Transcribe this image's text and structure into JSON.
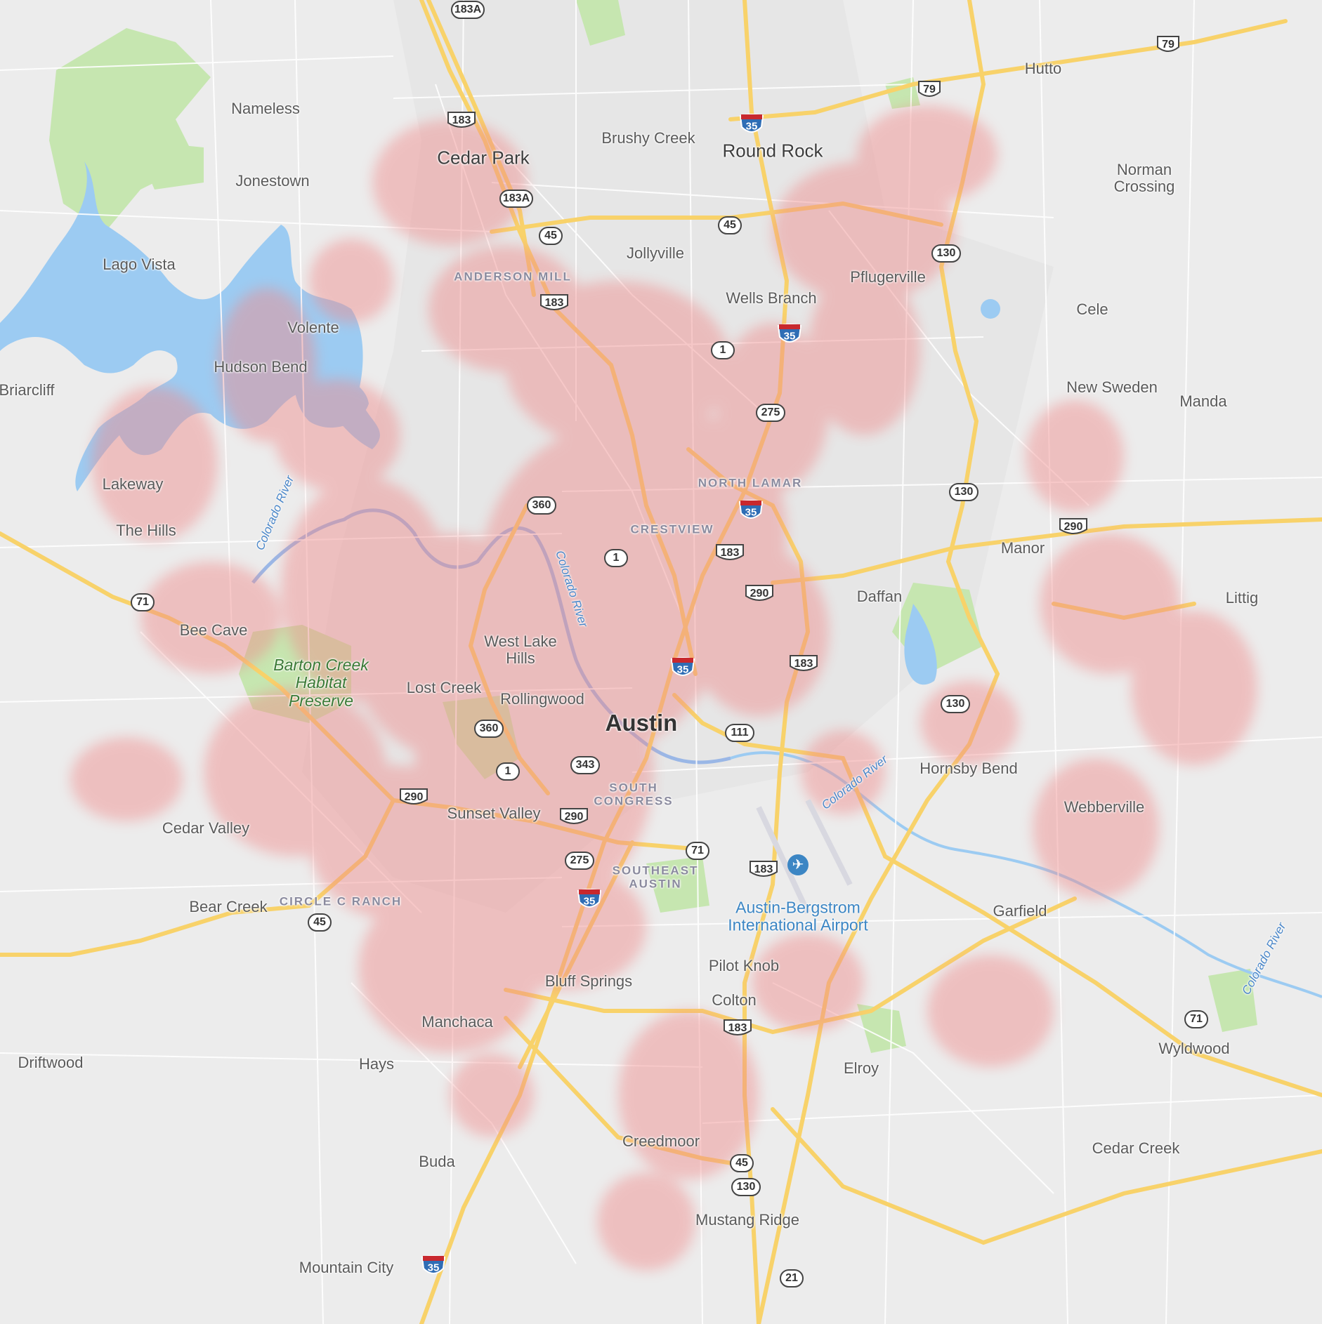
{
  "map": {
    "colors": {
      "land": "#ececec",
      "park": "#c6e6b0",
      "water": "#9ccbf2",
      "highway": "#f8d26a",
      "road": "#ffffff",
      "heat": "#f08a8a",
      "airport": "#3c86c4"
    },
    "places": [
      {
        "name": "Nameless",
        "style": "town"
      },
      {
        "name": "Jonestown",
        "style": "town"
      },
      {
        "name": "Lago Vista",
        "style": "town"
      },
      {
        "name": "Volente",
        "style": "town"
      },
      {
        "name": "Hudson Bend",
        "style": "town"
      },
      {
        "name": "Briarcliff",
        "style": "town"
      },
      {
        "name": "Lakeway",
        "style": "town"
      },
      {
        "name": "The Hills",
        "style": "town"
      },
      {
        "name": "Bee Cave",
        "style": "town"
      },
      {
        "name": "Cedar Park",
        "style": "big"
      },
      {
        "name": "Brushy Creek",
        "style": "town"
      },
      {
        "name": "Round Rock",
        "style": "big"
      },
      {
        "name": "Hutto",
        "style": "town"
      },
      {
        "name": "Norman Crossing",
        "style": "town"
      },
      {
        "name": "Jollyville",
        "style": "town"
      },
      {
        "name": "Pflugerville",
        "style": "town"
      },
      {
        "name": "Wells Branch",
        "style": "town"
      },
      {
        "name": "Cele",
        "style": "town"
      },
      {
        "name": "New Sweden",
        "style": "town"
      },
      {
        "name": "Manda",
        "style": "town"
      },
      {
        "name": "Manor",
        "style": "town"
      },
      {
        "name": "Daffan",
        "style": "town"
      },
      {
        "name": "Littig",
        "style": "town"
      },
      {
        "name": "West Lake Hills",
        "style": "town"
      },
      {
        "name": "Lost Creek",
        "style": "town"
      },
      {
        "name": "Rollingwood",
        "style": "town"
      },
      {
        "name": "Austin",
        "style": "city"
      },
      {
        "name": "Hornsby Bend",
        "style": "town"
      },
      {
        "name": "Webberville",
        "style": "town"
      },
      {
        "name": "Cedar Valley",
        "style": "town"
      },
      {
        "name": "Sunset Valley",
        "style": "town"
      },
      {
        "name": "Bear Creek",
        "style": "town"
      },
      {
        "name": "Garfield",
        "style": "town"
      },
      {
        "name": "Pilot Knob",
        "style": "town"
      },
      {
        "name": "Colton",
        "style": "town"
      },
      {
        "name": "Bluff Springs",
        "style": "town"
      },
      {
        "name": "Manchaca",
        "style": "town"
      },
      {
        "name": "Hays",
        "style": "town"
      },
      {
        "name": "Driftwood",
        "style": "town"
      },
      {
        "name": "Elroy",
        "style": "town"
      },
      {
        "name": "Wyldwood",
        "style": "town"
      },
      {
        "name": "Creedmoor",
        "style": "town"
      },
      {
        "name": "Cedar Creek",
        "style": "town"
      },
      {
        "name": "Buda",
        "style": "town"
      },
      {
        "name": "Mustang Ridge",
        "style": "town"
      },
      {
        "name": "Mountain City",
        "style": "town"
      }
    ],
    "neighborhoods": [
      "ANDERSON MILL",
      "NORTH LAMAR",
      "CRESTVIEW",
      "SOUTH CONGRESS",
      "SOUTHEAST AUSTIN",
      "CIRCLE C RANCH"
    ],
    "parks": [
      "Barton Creek Habitat Preserve"
    ],
    "pois": [
      "Austin-Bergstrom International Airport"
    ],
    "water_labels": [
      "Colorado River"
    ],
    "shields": [
      {
        "type": "state",
        "ref": "183A"
      },
      {
        "type": "us",
        "ref": "183"
      },
      {
        "type": "state",
        "ref": "183A"
      },
      {
        "type": "state",
        "ref": "45"
      },
      {
        "type": "us",
        "ref": "183"
      },
      {
        "type": "interstate",
        "ref": "35"
      },
      {
        "type": "us",
        "ref": "79"
      },
      {
        "type": "us",
        "ref": "79"
      },
      {
        "type": "state",
        "ref": "45"
      },
      {
        "type": "state",
        "ref": "130"
      },
      {
        "type": "interstate",
        "ref": "35"
      },
      {
        "type": "state",
        "ref": "1"
      },
      {
        "type": "state",
        "ref": "275"
      },
      {
        "type": "state",
        "ref": "130"
      },
      {
        "type": "state",
        "ref": "360"
      },
      {
        "type": "interstate",
        "ref": "35"
      },
      {
        "type": "us",
        "ref": "290"
      },
      {
        "type": "state",
        "ref": "1"
      },
      {
        "type": "us",
        "ref": "183"
      },
      {
        "type": "us",
        "ref": "290"
      },
      {
        "type": "state",
        "ref": "71"
      },
      {
        "type": "interstate",
        "ref": "35"
      },
      {
        "type": "us",
        "ref": "183"
      },
      {
        "type": "state",
        "ref": "130"
      },
      {
        "type": "state",
        "ref": "360"
      },
      {
        "type": "state",
        "ref": "111"
      },
      {
        "type": "state",
        "ref": "1"
      },
      {
        "type": "state",
        "ref": "343"
      },
      {
        "type": "us",
        "ref": "290"
      },
      {
        "type": "us",
        "ref": "290"
      },
      {
        "type": "state",
        "ref": "275"
      },
      {
        "type": "state",
        "ref": "71"
      },
      {
        "type": "us",
        "ref": "183"
      },
      {
        "type": "interstate",
        "ref": "35"
      },
      {
        "type": "state",
        "ref": "45"
      },
      {
        "type": "us",
        "ref": "183"
      },
      {
        "type": "state",
        "ref": "71"
      },
      {
        "type": "state",
        "ref": "45"
      },
      {
        "type": "state",
        "ref": "130"
      },
      {
        "type": "interstate",
        "ref": "35"
      },
      {
        "type": "state",
        "ref": "21"
      }
    ]
  }
}
